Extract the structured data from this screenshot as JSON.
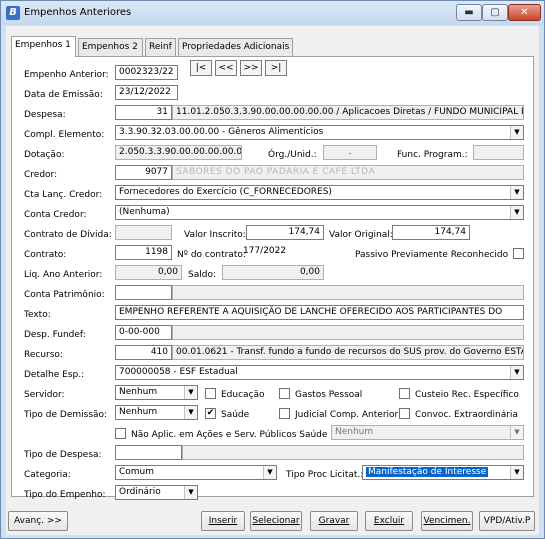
{
  "window": {
    "title": "Empenhos Anteriores",
    "app_icon": "B",
    "min": "▬",
    "max": "▢",
    "close": "✕"
  },
  "tabs": [
    "Empenhos 1",
    "Empenhos 2",
    "Reinf",
    "Propriedades Adicionais"
  ],
  "labels": {
    "empenho_anterior": "Empenho Anterior:",
    "data_emissao": "Data de Emissão:",
    "despesa": "Despesa:",
    "compl_elemento": "Compl. Elemento:",
    "dotacao": "Dotação:",
    "org_unid": "Órg./Unid.:",
    "func_program": "Func. Program.:",
    "credor": "Credor:",
    "cta_lanc_credor": "Cta Lanç. Credor:",
    "conta_credor": "Conta Credor:",
    "contrato_divida": "Contrato de Dívida:",
    "valor_inscrito": "Valor Inscrito:",
    "valor_original": "Valor Original:",
    "contrato": "Contrato:",
    "n_contrato": "Nº do contrato:",
    "passivo": "Passivo Previamente Reconhecido",
    "liq_ano_anterior": "Liq. Ano Anterior:",
    "saldo": "Saldo:",
    "conta_patrimonio": "Conta Patrimônio:",
    "texto": "Texto:",
    "desp_fundef": "Desp. Fundef:",
    "recurso": "Recurso:",
    "detalhe_esp": "Detalhe Esp.:",
    "servidor": "Servidor:",
    "educacao": "Educação",
    "gastos_pessoal": "Gastos Pessoal",
    "custeio": "Custeio Rec. Específico",
    "tipo_demissao": "Tipo de Demissão:",
    "saude": "Saúde",
    "judicial": "Judicial Comp. Anterior",
    "convoc": "Convoc. Extraordinária",
    "nao_aplic": "Não Aplic. em Ações e Serv. Públicos Saúde",
    "tipo_despesa": "Tipo de Despesa:",
    "categoria": "Categoria:",
    "tipo_proc_licitat": "Tipo Proc Licitat.:",
    "tipo_empenho": "Tipo do Empenho:"
  },
  "values": {
    "empenho_anterior": "0002323/22",
    "data_emissao": "23/12/2022",
    "despesa_code": "31",
    "despesa_desc": "11.01.2.050.3.3.90.00.00.00.00.00 / Aplicacoes Diretas / FUNDO MUNICIPAL D",
    "compl_elemento": "3.3.90.32.03.00.00.00 - Gêneros Alimentícios",
    "dotacao": "2.050.3.3.90.00.00.00.00.00",
    "org_unid": ".",
    "credor_code": "9077",
    "credor_name": "SABORES DO PAO PADARIA E CAFE LTDA",
    "cta_lanc_credor": "Fornecedores do Exercício (C_FORNECEDORES)",
    "conta_credor": "(Nenhuma)",
    "valor_inscrito": "174,74",
    "valor_original": "174,74",
    "contrato_code": "1198",
    "n_contrato": "177/2022",
    "liq_ano_anterior": "0,00",
    "saldo": "0,00",
    "texto": "EMPENHO REFERENTE A AQUISIÇÃO DE LANCHE OFERECIDO AOS PARTICIPANTES DO",
    "desp_fundef": "0-00-000",
    "recurso_code": "410",
    "recurso_desc": "00.01.0621 - Transf. fundo a fundo de recursos do SUS prov. do Governo ESTAD",
    "detalhe_esp": "700000058 - ESF Estadual",
    "servidor": "Nenhum",
    "tipo_demissao": "Nenhum",
    "nao_aplic": "Nenhum",
    "categoria": "Comum",
    "tipo_proc_licitat": "Manifestação de Interesse",
    "tipo_empenho": "Ordinário"
  },
  "nav": {
    "first": "|<",
    "prev": "<<",
    "next": ">>",
    "last": ">|"
  },
  "buttons": {
    "avanc": "Avanç. >>",
    "inserir": "Inserir",
    "selecionar": "Selecionar",
    "gravar": "Gravar",
    "excluir": "Excluir",
    "vencimen": "Vencimen.",
    "vpd": "VPD/Ativ.P"
  },
  "checks": {
    "saude": true,
    "educacao": false,
    "gastos_pessoal": false,
    "custeio": false,
    "judicial": false,
    "convoc": false,
    "nao_aplic": false,
    "passivo": false
  }
}
